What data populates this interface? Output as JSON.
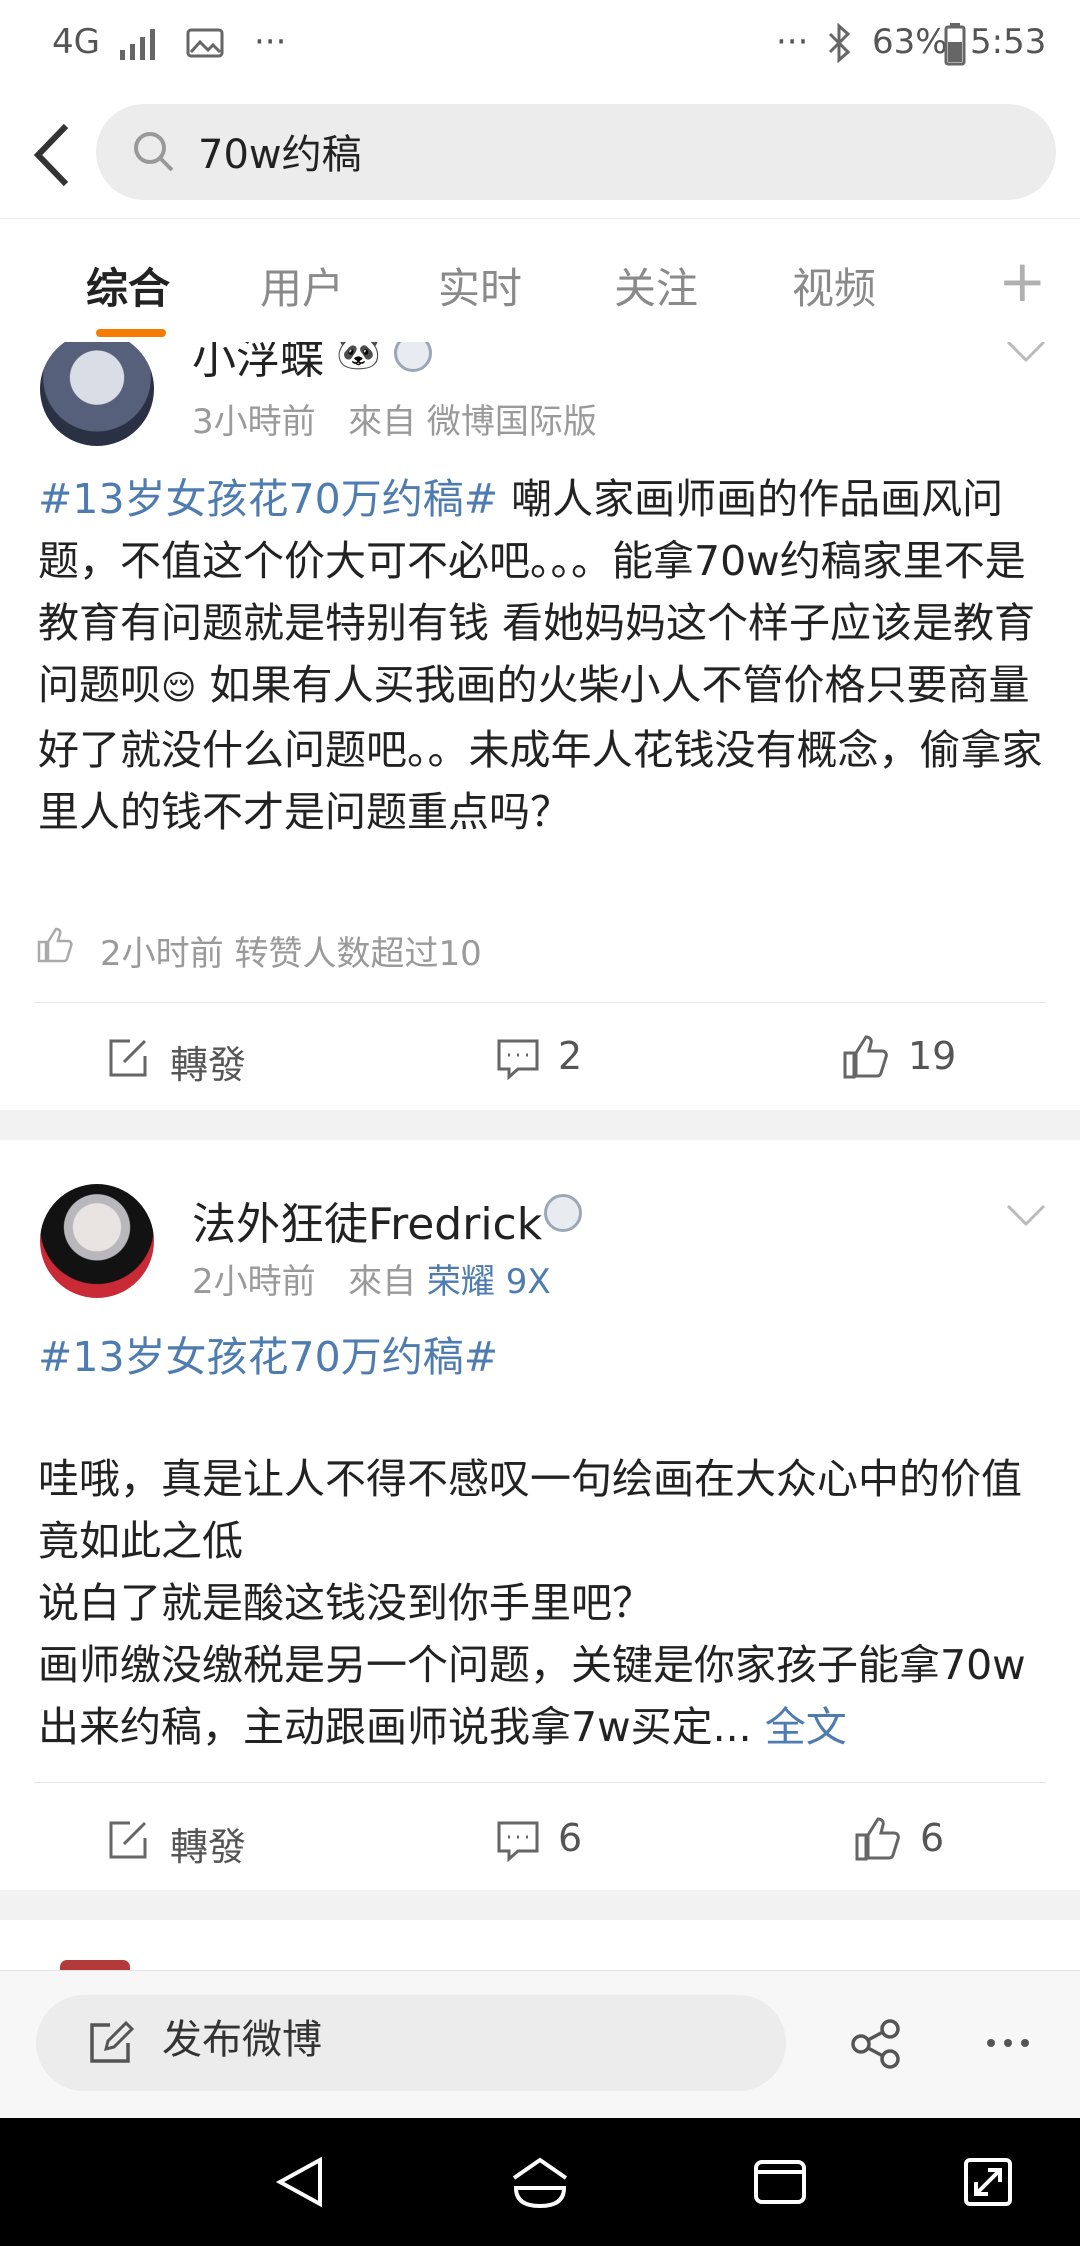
{
  "status_bar": {
    "network": "4G",
    "battery": "63%",
    "time": "5:53",
    "left_more": "···",
    "right_more": "···"
  },
  "search": {
    "value": "70w约稿"
  },
  "tabs": [
    {
      "label": "综合",
      "active": true
    },
    {
      "label": "用户"
    },
    {
      "label": "实时"
    },
    {
      "label": "关注"
    },
    {
      "label": "视频"
    }
  ],
  "tab_plus": "+",
  "posts": [
    {
      "user": "小浮蝶",
      "time": "3小時前",
      "source_prefix": "來自",
      "source": "微博国际版",
      "hashtag": "#13岁女孩花70万约稿#",
      "text": "嘲人家画师画的作品画风问题，不值这个价大可不必吧。。。能拿70w约稿家里不是教育有问题就是特别有钱 看她妈妈这个样子应该是教育问题呗",
      "text2": "如果有人买我画的火柴小人不管价格只要商量好了就没什么问题吧。。未成年人花钱没有概念，偷拿家里人的钱不才是问题重点吗？",
      "like_info": "2小时前 转赞人数超过10",
      "repost_label": "轉發",
      "comments": "2",
      "likes": "19"
    },
    {
      "user": "法外狂徒Fredrick",
      "time": "2小時前",
      "source_prefix": "來自",
      "source": "荣耀 9X",
      "hashtag": "#13岁女孩花70万约稿#",
      "line1": "哇哦，真是让人不得不感叹一句绘画在大众心中的价值竟如此之低",
      "line2": "说白了就是酸这钱没到你手里吧？",
      "line3": "画师缴没缴税是另一个问题，关键是你家孩子能拿70w出来约稿，主动跟画师说我拿7w买定...",
      "full_text_link": "全文",
      "repost_label": "轉發",
      "comments": "6",
      "likes": "6"
    }
  ],
  "bottom_bar": {
    "compose_label": "发布微博"
  },
  "colors": {
    "accent": "#f57c00",
    "link": "#4f7cb0"
  }
}
